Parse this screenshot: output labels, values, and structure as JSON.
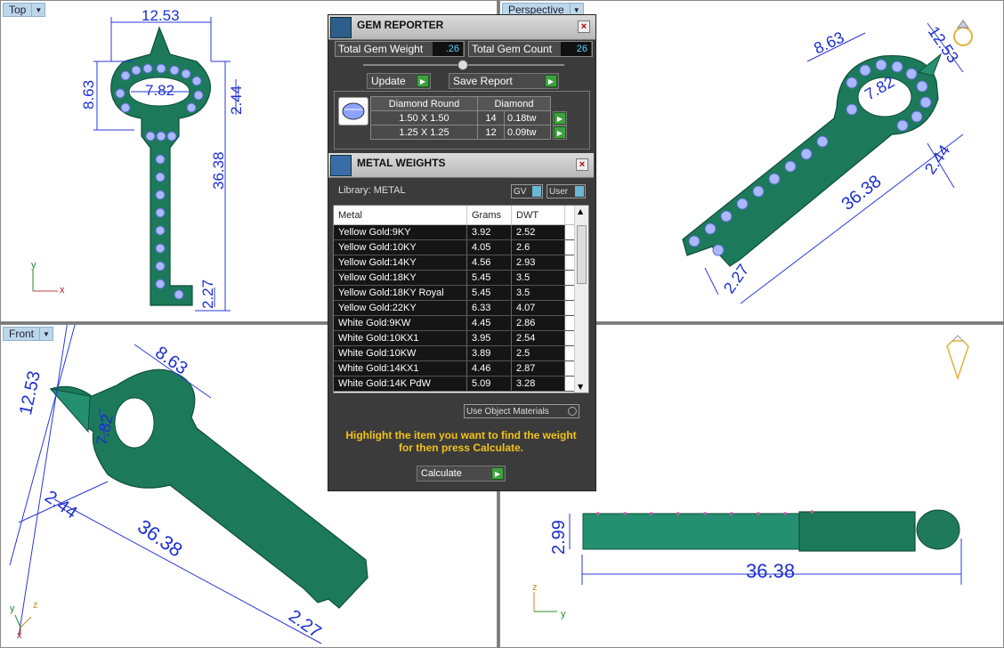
{
  "viewports": {
    "top": {
      "label": "Top",
      "dims": [
        "12.53",
        "8.63",
        "7.82",
        "2.44",
        "36.38",
        "2.27"
      ],
      "axes": {
        "y": "y",
        "x": "x"
      }
    },
    "perspective": {
      "label": "Perspective",
      "dims": [
        "8.63",
        "12.53",
        "7.82",
        "2.44",
        "36.38",
        "2.27"
      ]
    },
    "front": {
      "label": "Front",
      "dims": [
        "12.53",
        "8.63",
        "7.82",
        "2.44",
        "36.38",
        "2.27"
      ],
      "axes": {
        "y": "y",
        "z": "z",
        "x": "x"
      }
    },
    "right": {
      "dims": [
        "2.99",
        "36.38"
      ],
      "axes": {
        "z": "z",
        "y": "y"
      }
    }
  },
  "gem_reporter": {
    "title": "GEM REPORTER",
    "total_weight_label": "Total Gem Weight",
    "total_weight_value": ".26",
    "total_count_label": "Total Gem Count",
    "total_count_value": "26",
    "update_label": "Update",
    "save_report_label": "Save Report",
    "gem_type": "Diamond Round",
    "gem_material": "Diamond",
    "rows": [
      {
        "size": "1.50 X 1.50",
        "count": "14",
        "tw": "0.18tw"
      },
      {
        "size": "1.25 X 1.25",
        "count": "12",
        "tw": "0.09tw"
      }
    ]
  },
  "metal_weights": {
    "title": "METAL WEIGHTS",
    "library_label": "Library: METAL",
    "gv_label": "GV",
    "user_label": "User",
    "columns": [
      "Metal",
      "Grams",
      "DWT"
    ],
    "rows": [
      [
        "Yellow Gold:9KY",
        "3.92",
        "2.52"
      ],
      [
        "Yellow Gold:10KY",
        "4.05",
        "2.6"
      ],
      [
        "Yellow Gold:14KY",
        "4.56",
        "2.93"
      ],
      [
        "Yellow Gold:18KY",
        "5.45",
        "3.5"
      ],
      [
        "Yellow Gold:18KY Royal",
        "5.45",
        "3.5"
      ],
      [
        "Yellow Gold:22KY",
        "6.33",
        "4.07"
      ],
      [
        "White Gold:9KW",
        "4.45",
        "2.86"
      ],
      [
        "White Gold:10KX1",
        "3.95",
        "2.54"
      ],
      [
        "White Gold:10KW",
        "3.89",
        "2.5"
      ],
      [
        "White Gold:14KX1",
        "4.46",
        "2.87"
      ],
      [
        "White Gold:14K PdW",
        "5.09",
        "3.28"
      ]
    ],
    "use_object_materials": "Use Object Materials",
    "instruction_line1": "Highlight the item you want to find the weight",
    "instruction_line2": "for then press Calculate.",
    "calculate_label": "Calculate"
  }
}
